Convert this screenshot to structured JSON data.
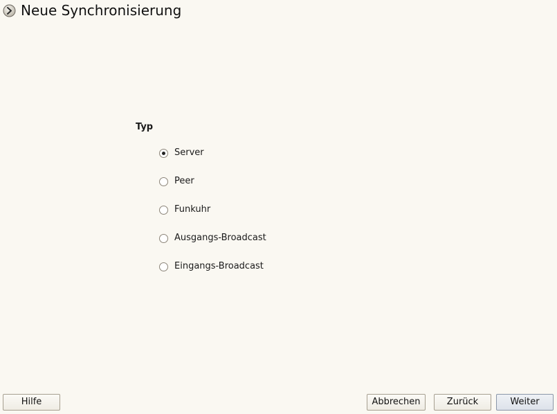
{
  "header": {
    "title": "Neue Synchronisierung",
    "icon": "wizard-arrow-icon"
  },
  "type_group": {
    "label": "Typ",
    "options": [
      {
        "label": "Server",
        "selected": true
      },
      {
        "label": "Peer",
        "selected": false
      },
      {
        "label": "Funkuhr",
        "selected": false
      },
      {
        "label": "Ausgangs-Broadcast",
        "selected": false
      },
      {
        "label": "Eingangs-Broadcast",
        "selected": false
      }
    ]
  },
  "buttons": {
    "help": "Hilfe",
    "cancel": "Abbrechen",
    "back": "Zurück",
    "next": "Weiter"
  }
}
